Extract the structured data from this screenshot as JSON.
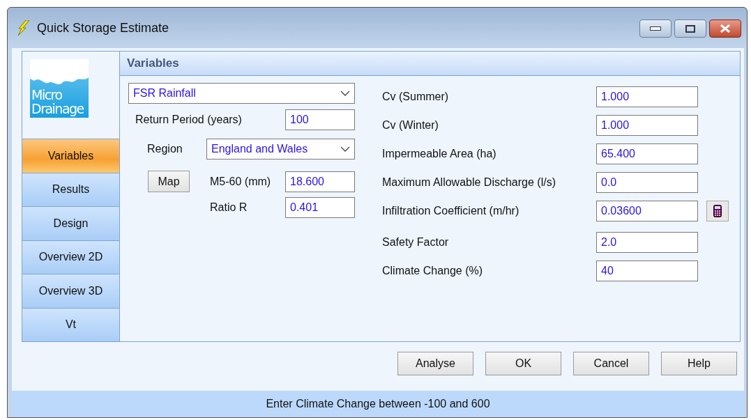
{
  "window": {
    "title": "Quick Storage Estimate"
  },
  "logo": {
    "lines": [
      "Micro",
      "Drainage"
    ]
  },
  "nav": [
    {
      "label": "Variables",
      "selected": true
    },
    {
      "label": "Results",
      "selected": false
    },
    {
      "label": "Design",
      "selected": false
    },
    {
      "label": "Overview 2D",
      "selected": false
    },
    {
      "label": "Overview 3D",
      "selected": false
    },
    {
      "label": "Vt",
      "selected": false
    }
  ],
  "section_title": "Variables",
  "rainfall_type": {
    "value": "FSR Rainfall"
  },
  "return_period": {
    "label": "Return Period (years)",
    "value": "100"
  },
  "region": {
    "label": "Region",
    "value": "England and Wales"
  },
  "map_button": "Map",
  "m5_60": {
    "label": "M5-60 (mm)",
    "value": "18.600"
  },
  "ratio_r": {
    "label": "Ratio R",
    "value": "0.401"
  },
  "right_fields": [
    {
      "label": "Cv (Summer)",
      "value": "1.000",
      "calculator": false
    },
    {
      "label": "Cv (Winter)",
      "value": "1.000",
      "calculator": false
    },
    {
      "label": "Impermeable Area (ha)",
      "value": "65.400",
      "calculator": false
    },
    {
      "label": "Maximum Allowable Discharge (l/s)",
      "value": "0.0",
      "calculator": false
    },
    {
      "label": "Infiltration Coefficient (m/hr)",
      "value": "0.03600",
      "calculator": true
    },
    {
      "label": "Safety Factor",
      "value": "2.0",
      "calculator": false
    },
    {
      "label": "Climate Change (%)",
      "value": "40",
      "calculator": false
    }
  ],
  "buttons": [
    "Analyse",
    "OK",
    "Cancel",
    "Help"
  ],
  "status_bar": "Enter Climate Change between -100 and 600"
}
